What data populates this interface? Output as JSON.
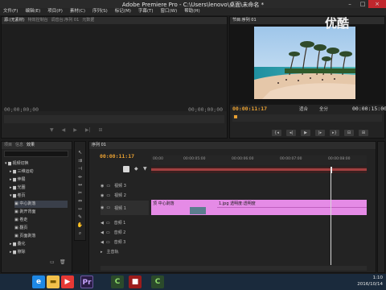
{
  "app_title": "Adobe Premiere Pro - C:\\Users\\lenovo\\桌面\\未命名 *",
  "watermark": "优酷",
  "menu": [
    "文件(F)",
    "编辑(E)",
    "项目(P)",
    "素材(C)",
    "序列(S)",
    "标记(M)",
    "字幕(T)",
    "窗口(W)",
    "帮助(H)"
  ],
  "source_panel": {
    "tabs": [
      "源:(无素材)",
      "特效控制台",
      "调音台:序列 01",
      "元数据"
    ],
    "timecode_left": "00;00;00;00",
    "timecode_right": "00;00;00;00"
  },
  "program_panel": {
    "tab": "节目:序列 01",
    "timecode_current": "00:00:11:17",
    "fit_label": "适合",
    "quality_label": "全分",
    "timecode_total": "00:00:15:00"
  },
  "project_panel": {
    "tabs": [
      "项目",
      "信息",
      "效果"
    ],
    "items": [
      {
        "label": "视频切换",
        "level": 0
      },
      {
        "label": "三维运动",
        "level": 1
      },
      {
        "label": "伸展",
        "level": 1
      },
      {
        "label": "光圈",
        "level": 1
      },
      {
        "label": "卷页",
        "level": 1
      },
      {
        "label": "中心剥落",
        "level": 2,
        "selected": true
      },
      {
        "label": "剥开背面",
        "level": 2
      },
      {
        "label": "卷走",
        "level": 2
      },
      {
        "label": "翻页",
        "level": 2
      },
      {
        "label": "页面剥落",
        "level": 2
      },
      {
        "label": "叠化",
        "level": 1
      },
      {
        "label": "擦除",
        "level": 1
      }
    ]
  },
  "timeline_panel": {
    "tab": "序列 01",
    "timecode": "00:00:11:17",
    "ruler": [
      "00;00",
      "00:00:05:00",
      "00:00:06:00",
      "00:00:07:00",
      "00:00:08:00"
    ],
    "video_tracks": [
      "视频 3",
      "视频 2",
      "视频 1"
    ],
    "audio_tracks": [
      "音频 1",
      "音频 2",
      "音频 3",
      "主音轨"
    ],
    "clip1_label": "顶 中心剥落",
    "clip2_label": "1.jpg 透明度:透明度"
  },
  "taskbar": {
    "time": "1:10",
    "date": "2016/10/14",
    "apps": [
      "ie",
      "folder",
      "media",
      "premiere",
      "camtasia",
      "app",
      "camtasia2"
    ]
  },
  "colors": {
    "accent_orange": "#e8a032",
    "clip_pink": "#e58be6",
    "close_red": "#c1272d",
    "taskbar_blue": "#1a2a3c"
  }
}
